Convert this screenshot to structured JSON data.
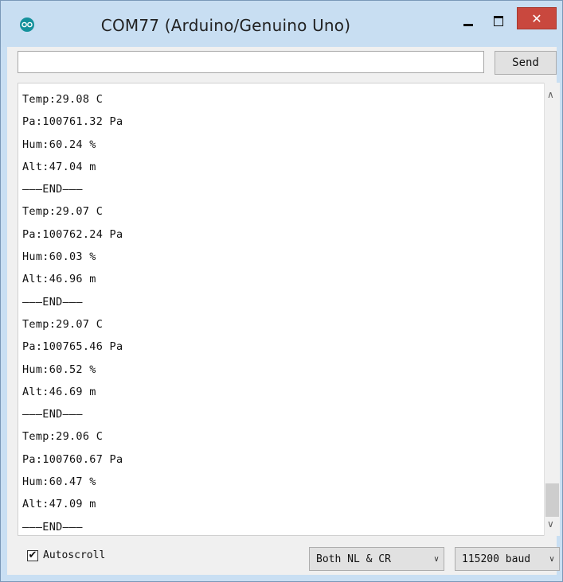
{
  "window": {
    "title": "COM77 (Arduino/Genuino Uno)",
    "close_glyph": "✕"
  },
  "toolbar": {
    "input_value": "",
    "send_label": "Send"
  },
  "output": {
    "lines": [
      "Temp:29.08 C",
      "Pa:100761.32 Pa",
      "Hum:60.24 %",
      "Alt:47.04 m",
      "———END———",
      "Temp:29.07 C",
      "Pa:100762.24 Pa",
      "Hum:60.03 %",
      "Alt:46.96 m",
      "———END———",
      "Temp:29.07 C",
      "Pa:100765.46 Pa",
      "Hum:60.52 %",
      "Alt:46.69 m",
      "———END———",
      "Temp:29.06 C",
      "Pa:100760.67 Pa",
      "Hum:60.47 %",
      "Alt:47.09 m",
      "———END———"
    ]
  },
  "footer": {
    "autoscroll_label": "Autoscroll",
    "autoscroll_checked": true,
    "line_ending": "Both NL & CR",
    "baud_rate": "115200 baud"
  },
  "colors": {
    "titlebar": "#c8def2",
    "close_button": "#c9483e",
    "arduino_icon": "#15919c"
  }
}
